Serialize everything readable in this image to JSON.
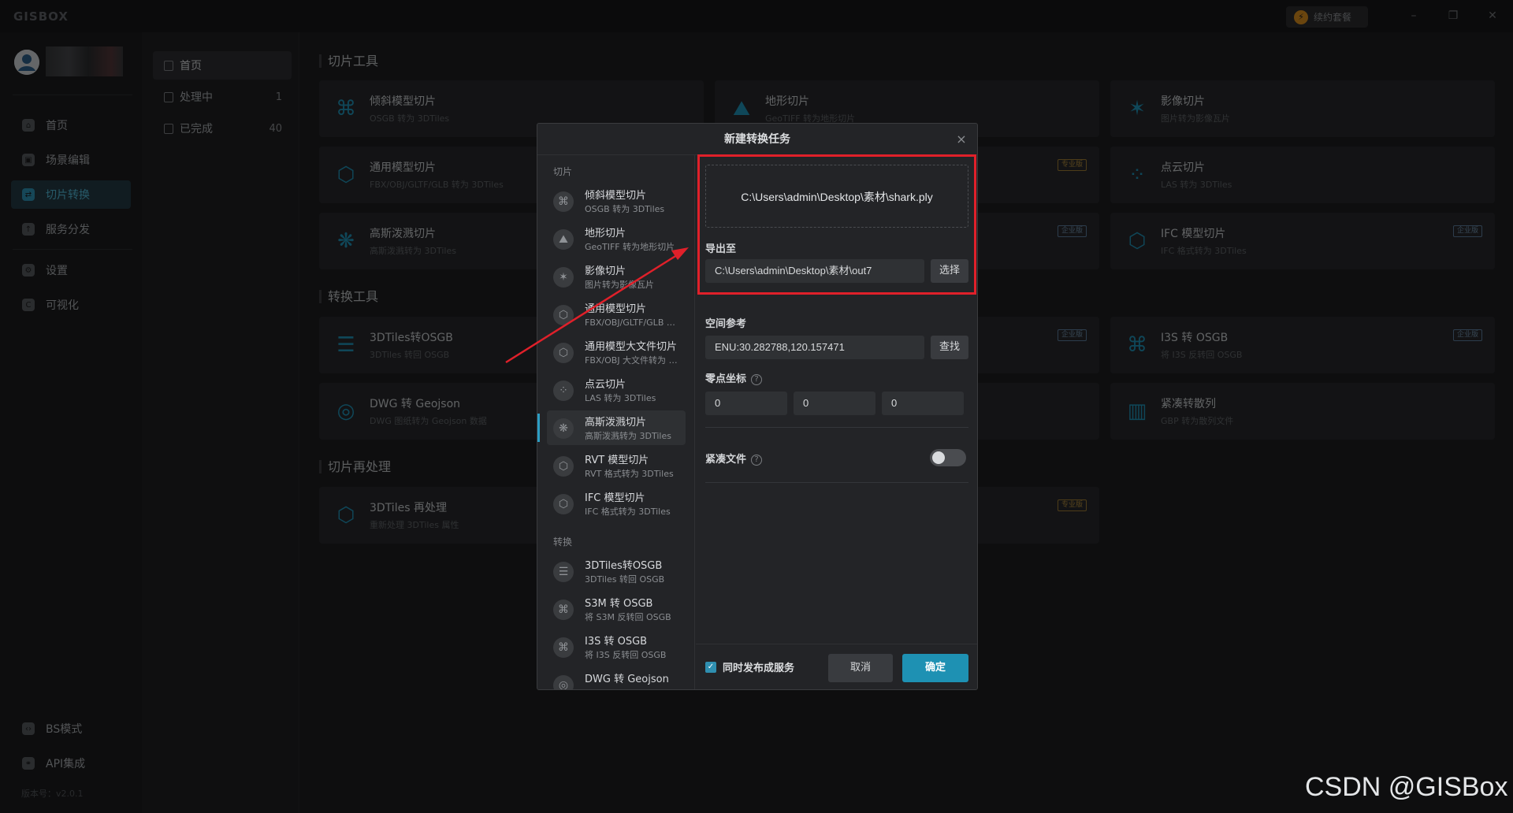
{
  "app": {
    "logo": "GISBOX",
    "renew_label": "续约套餐",
    "version": "版本号：v2.0.1"
  },
  "window_controls": [
    "–",
    "❐",
    "✕"
  ],
  "nav": {
    "items": [
      {
        "label": "首页",
        "icon": "home-icon"
      },
      {
        "label": "场景编辑",
        "icon": "cube-icon"
      },
      {
        "label": "切片转换",
        "icon": "convert-icon",
        "active": true
      },
      {
        "label": "服务分发",
        "icon": "upload-icon"
      },
      {
        "label": "设置",
        "icon": "gear-icon"
      },
      {
        "label": "可视化",
        "icon": "chart-icon"
      }
    ],
    "bottom": [
      {
        "label": "BS模式",
        "icon": "code-icon"
      },
      {
        "label": "API集成",
        "icon": "link-icon"
      }
    ]
  },
  "subnav": {
    "items": [
      {
        "label": "首页",
        "count": "",
        "active": true
      },
      {
        "label": "处理中",
        "count": "1"
      },
      {
        "label": "已完成",
        "count": "40"
      }
    ]
  },
  "main": {
    "sections": [
      "切片工具",
      "转换工具",
      "切片再处理"
    ],
    "cards": [
      {
        "title": "倾斜模型切片",
        "sub": "OSGB 转为 3DTiles",
        "icon": "⌘"
      },
      {
        "title": "地形切片",
        "sub": "GeoTIFF 转为地形切片",
        "icon": "⛰"
      },
      {
        "title": "影像切片",
        "sub": "图片转为影像瓦片",
        "icon": "✶"
      },
      {
        "title": "通用模型切片",
        "sub": "FBX/OBJ/GLTF/GLB 转为 3DTiles",
        "icon": "⬡"
      },
      {
        "title": "",
        "sub": "",
        "icon": "",
        "badge": "专业版"
      },
      {
        "title": "点云切片",
        "sub": "LAS 转为 3DTiles",
        "icon": "⁘"
      },
      {
        "title": "高斯泼溅切片",
        "sub": "高斯泼溅转为 3DTiles",
        "icon": "❋"
      },
      {
        "title": "",
        "sub": "",
        "icon": "",
        "badge": "企业版"
      },
      {
        "title": "IFC 模型切片",
        "sub": "IFC 格式转为 3DTiles",
        "icon": "⬡",
        "badge": "企业版"
      },
      {
        "title": "3DTiles转OSGB",
        "sub": "3DTiles 转回 OSGB",
        "icon": "☰"
      },
      {
        "title": "",
        "sub": "",
        "icon": "",
        "badge": "企业版"
      },
      {
        "title": "I3S 转 OSGB",
        "sub": "将 I3S 反转回 OSGB",
        "icon": "⌘",
        "badge": "企业版"
      },
      {
        "title": "DWG 转 Geojson",
        "sub": "DWG 图纸转为 Geojson 数据",
        "icon": "◎"
      },
      {
        "title": "",
        "sub": "",
        "icon": ""
      },
      {
        "title": "紧凑转散列",
        "sub": "GBP 转为散列文件",
        "icon": "▥"
      },
      {
        "title": "3DTiles 再处理",
        "sub": "重新处理 3DTiles 属性",
        "icon": "⬡"
      },
      {
        "title": "",
        "sub": "",
        "icon": "",
        "badge": "专业版"
      }
    ]
  },
  "dialog": {
    "title": "新建转换任务",
    "groups": [
      "切片",
      "转换"
    ],
    "list": [
      {
        "title": "倾斜模型切片",
        "sub": "OSGB 转为 3DTiles",
        "icon": "⌘"
      },
      {
        "title": "地形切片",
        "sub": "GeoTIFF 转为地形切片",
        "icon": "⛰"
      },
      {
        "title": "影像切片",
        "sub": "图片转为影像瓦片",
        "icon": "✶"
      },
      {
        "title": "通用模型切片",
        "sub": "FBX/OBJ/GLTF/GLB 转为 3DTiles",
        "icon": "⬡"
      },
      {
        "title": "通用模型大文件切片",
        "sub": "FBX/OBJ 大文件转为 3DTiles",
        "icon": "⬡"
      },
      {
        "title": "点云切片",
        "sub": "LAS 转为 3DTiles",
        "icon": "⁘"
      },
      {
        "title": "高斯泼溅切片",
        "sub": "高斯泼溅转为 3DTiles",
        "icon": "❋",
        "active": true
      },
      {
        "title": "RVT 模型切片",
        "sub": "RVT 格式转为 3DTiles",
        "icon": "⬡"
      },
      {
        "title": "IFC 模型切片",
        "sub": "IFC 格式转为 3DTiles",
        "icon": "⬡"
      },
      {
        "title": "3DTiles转OSGB",
        "sub": "3DTiles 转回 OSGB",
        "icon": "☰"
      },
      {
        "title": "S3M 转 OSGB",
        "sub": "将 S3M 反转回 OSGB",
        "icon": "⌘"
      },
      {
        "title": "I3S 转 OSGB",
        "sub": "将 I3S 反转回 OSGB",
        "icon": "⌘"
      },
      {
        "title": "DWG 转 Geojson",
        "sub": "",
        "icon": "◎"
      }
    ],
    "source_file": "C:\\Users\\admin\\Desktop\\素材\\shark.ply",
    "export_label": "导出至",
    "export_path": "C:\\Users\\admin\\Desktop\\素材\\out7",
    "select_label": "选择",
    "spatial_label": "空间参考",
    "spatial_value": "ENU:30.282788,120.157471",
    "find_label": "查找",
    "origin_label": "零点坐标",
    "origin": [
      "0",
      "0",
      "0"
    ],
    "compact_label": "紧凑文件",
    "compact_on": false,
    "publish_label": "同时发布成服务",
    "publish_checked": true,
    "cancel_label": "取消",
    "ok_label": "确定"
  },
  "watermark": "CSDN @GISBox"
}
